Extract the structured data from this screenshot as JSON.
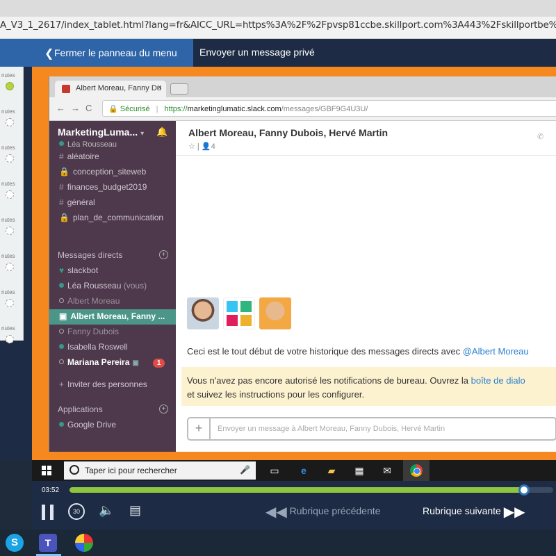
{
  "browser": {
    "url_text": "A_V3_1_2617/index_tablet.html?lang=fr&AICC_URL=https%3A%2F%2Fpvsp81ccbe.skillport.com%3A443%2Fskillportbe%2Fsp"
  },
  "nav": {
    "close_menu_label": "Fermer le panneau du menu",
    "title": "Envoyer un message privé"
  },
  "left_panel": {
    "items": [
      {
        "label": "nutes",
        "done": true
      },
      {
        "label": "nutes",
        "done": false
      },
      {
        "label": "nutes",
        "done": false
      },
      {
        "label": "nutes",
        "done": false
      },
      {
        "label": "nutes",
        "done": false
      },
      {
        "label": "nutes",
        "done": false
      },
      {
        "label": "nutes",
        "done": false
      },
      {
        "label": "nutes",
        "done": false
      }
    ]
  },
  "chrome": {
    "tab_title": "Albert Moreau, Fanny Du",
    "tab_close": "×",
    "secure_label": "Sécurisé",
    "url_scheme": "https://",
    "url_host": "marketinglumatic.slack.com",
    "url_path": "/messages/GBF9G4U3U/"
  },
  "slack": {
    "team_name": "MarketingLuma...",
    "team_dropdown": "▾",
    "current_user": "Léa Rousseau",
    "channels": [
      {
        "prefix": "#",
        "name": "aléatoire"
      },
      {
        "prefix": "🔒",
        "name": "conception_siteweb"
      },
      {
        "prefix": "#",
        "name": "finances_budget2019"
      },
      {
        "prefix": "#",
        "name": "général"
      },
      {
        "prefix": "🔒",
        "name": "plan_de_communication"
      }
    ],
    "dm_header": "Messages directs",
    "dms": [
      {
        "name": "slackbot",
        "status": "heart"
      },
      {
        "name": "Léa Rousseau",
        "suffix": "(vous)",
        "status": "online"
      },
      {
        "name": "Albert Moreau",
        "status": "offline"
      },
      {
        "name": "Albert Moreau, Fanny ...",
        "status": "group",
        "selected": true
      },
      {
        "name": "Fanny Dubois",
        "status": "offline"
      },
      {
        "name": "Isabella Roswell",
        "status": "online"
      },
      {
        "name": "Mariana Pereira",
        "status": "offline",
        "badge": "1",
        "bold": true
      }
    ],
    "invite_label": "Inviter des personnes",
    "apps_header": "Applications",
    "apps": [
      {
        "name": "Google Drive"
      }
    ],
    "chat_title": "Albert Moreau, Fanny Dubois, Hervé Martin",
    "member_count": "4",
    "intro_text": "Ceci est le tout début de votre historique des messages directs avec ",
    "intro_link": "@Albert Moreau",
    "notice_line1": "Vous n'avez pas encore autorisé les notifications de bureau. Ouvrez la ",
    "notice_link": "boîte de dialo",
    "notice_line2": "et suivez les instructions pour les configurer.",
    "message_placeholder": "Envoyer un message à Albert Moreau, Fanny Dubois, Hervé Martin"
  },
  "taskbar": {
    "search_placeholder": "Taper ici pour rechercher"
  },
  "player": {
    "time": "03:52",
    "progress_fraction": 0.94,
    "replay_label": "30",
    "prev_label": "Rubrique précédente",
    "next_label": "Rubrique suivante"
  },
  "colors": {
    "accent_orange": "#f5891f",
    "slack_sidebar": "#4d394b",
    "progress_green": "#8fc640",
    "nav_blue": "#2e64a8"
  }
}
